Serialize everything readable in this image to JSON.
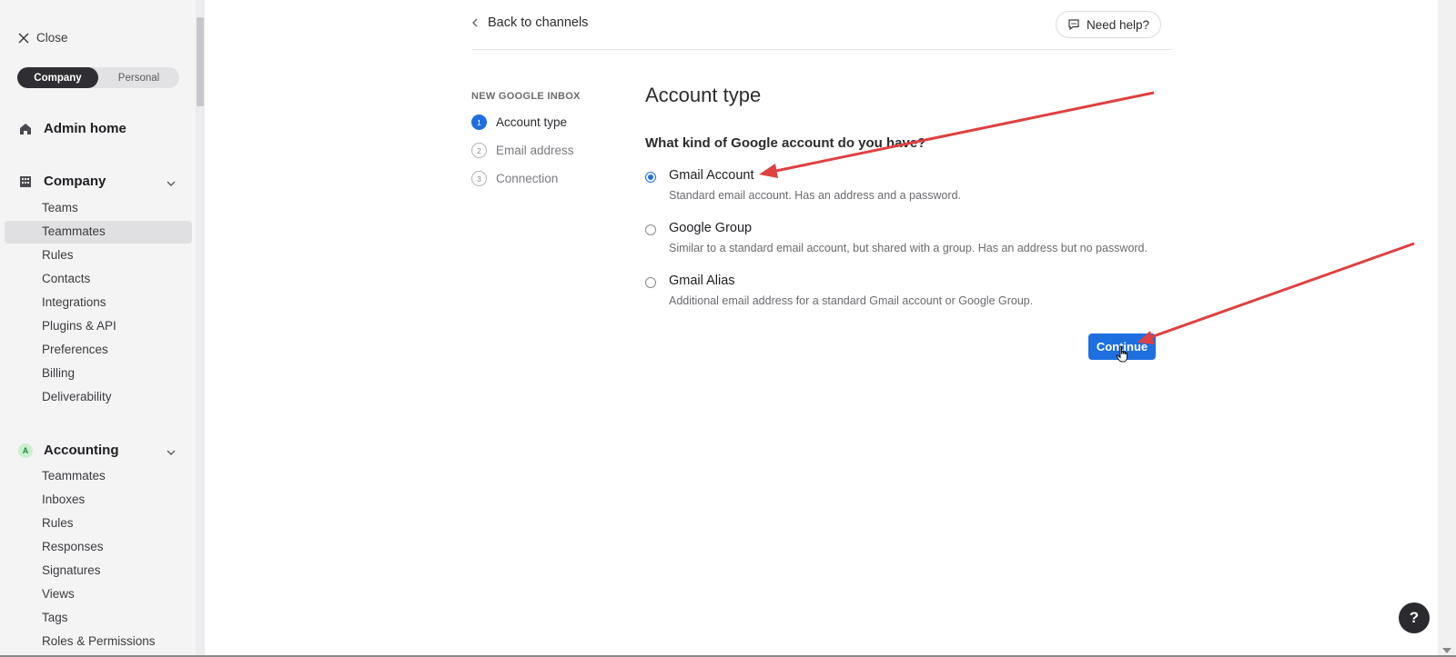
{
  "sidebar": {
    "close_label": "Close",
    "segment": {
      "company": "Company",
      "personal": "Personal"
    },
    "admin_home": "Admin home",
    "company": {
      "label": "Company",
      "items": [
        "Teams",
        "Teammates",
        "Rules",
        "Contacts",
        "Integrations",
        "Plugins & API",
        "Preferences",
        "Billing",
        "Deliverability"
      ]
    },
    "accounting": {
      "badge": "A",
      "label": "Accounting",
      "items": [
        "Teammates",
        "Inboxes",
        "Rules",
        "Responses",
        "Signatures",
        "Views",
        "Tags",
        "Roles & Permissions"
      ]
    }
  },
  "header": {
    "back_label": "Back to channels",
    "help_label": "Need help?"
  },
  "steps": {
    "title": "NEW GOOGLE INBOX",
    "items": [
      {
        "num": "1",
        "label": "Account type"
      },
      {
        "num": "2",
        "label": "Email address"
      },
      {
        "num": "3",
        "label": "Connection"
      }
    ]
  },
  "main": {
    "title": "Account type",
    "question": "What kind of Google account do you have?",
    "options": [
      {
        "label": "Gmail Account",
        "desc": "Standard email account. Has an address and a password.",
        "checked": true
      },
      {
        "label": "Google Group",
        "desc": "Similar to a standard email account, but shared with a group. Has an address but no password.",
        "checked": false
      },
      {
        "label": "Gmail Alias",
        "desc": "Additional email address for a standard Gmail account or Google Group.",
        "checked": false
      }
    ],
    "continue_label": "Continue"
  },
  "help_fab": "?",
  "colors": {
    "accent": "#1e6fe0",
    "annotation": "#e04040"
  }
}
